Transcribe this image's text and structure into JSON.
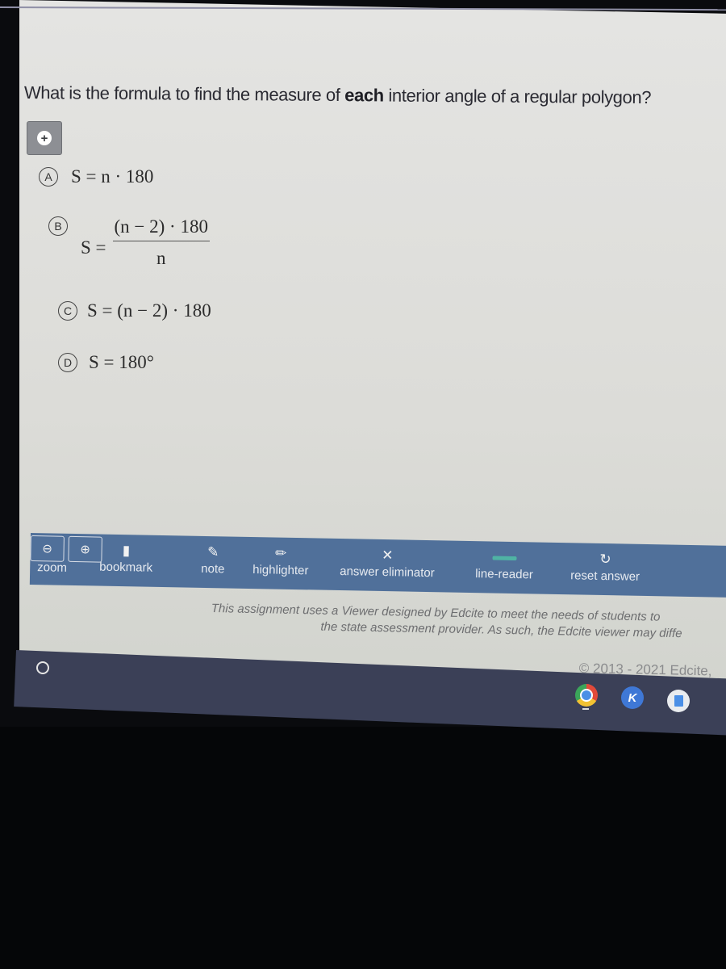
{
  "question": {
    "text_before": "What is the formula to find the measure of ",
    "text_bold": "each",
    "text_after": " interior angle of a regular polygon?"
  },
  "expand_button": {
    "icon": "plus-circle-icon"
  },
  "choices": [
    {
      "letter": "A",
      "formula": "S = n · 180"
    },
    {
      "letter": "B",
      "lhs": "S =",
      "numerator": "(n − 2) · 180",
      "denominator": "n"
    },
    {
      "letter": "C",
      "formula": "S = (n − 2) · 180"
    },
    {
      "letter": "D",
      "formula": "S = 180°"
    }
  ],
  "toolbar": {
    "accent_color": "#50709a",
    "zoom_label": "zoom",
    "zoom_out_icon": "zoom-out-icon",
    "zoom_in_icon": "zoom-in-icon",
    "bookmark_label": "bookmark",
    "note_label": "note",
    "highlighter_label": "highlighter",
    "answer_eliminator_label": "answer eliminator",
    "line_reader_label": "line-reader",
    "reset_answer_label": "reset answer"
  },
  "footer": {
    "disclaimer_line1": "This assignment uses a Viewer designed by Edcite to meet the needs of students to",
    "disclaimer_line2": "the state assessment provider. As such, the Edcite viewer may diffe",
    "copyright": "© 2013 - 2021 Edcite,"
  },
  "shelf": {
    "apps": [
      {
        "name": "Chrome",
        "icon": "chrome-icon"
      },
      {
        "name": "Kami",
        "icon": "kami-icon",
        "glyph": "K"
      },
      {
        "name": "Docs",
        "icon": "docs-icon"
      }
    ]
  }
}
